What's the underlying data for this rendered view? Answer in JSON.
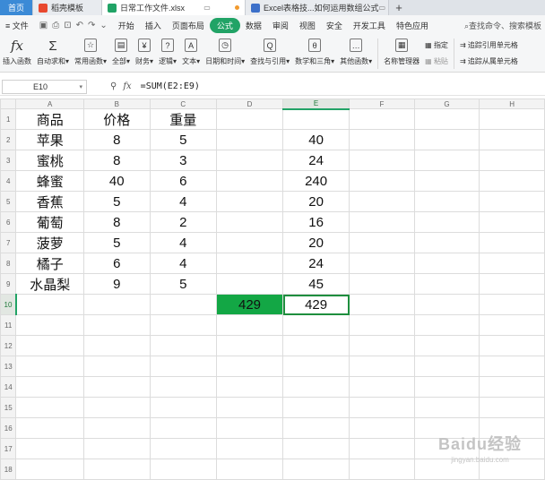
{
  "tabs": {
    "home": "首页",
    "tab1": "稻壳模板",
    "tab2": "日常工作文件.xlsx",
    "tab3": "Excel表格技...如何运用数组公式",
    "new_tab": "+"
  },
  "menu": {
    "file": "文件",
    "items": [
      "开始",
      "插入",
      "页面布局",
      "公式",
      "数据",
      "审阅",
      "视图",
      "安全",
      "开发工具",
      "特色应用"
    ],
    "active": "公式",
    "search": "查找命令、搜索模板"
  },
  "ribbon": {
    "buttons": [
      {
        "label": "插入函数",
        "icon": "fx"
      },
      {
        "label": "自动求和▾",
        "icon": "Σ"
      },
      {
        "label": "常用函数▾",
        "icon": "☆"
      },
      {
        "label": "全部▾",
        "icon": "▤"
      },
      {
        "label": "财务▾",
        "icon": "¥"
      },
      {
        "label": "逻辑▾",
        "icon": "?"
      },
      {
        "label": "文本▾",
        "icon": "A"
      },
      {
        "label": "日期和时间▾",
        "icon": "◷"
      },
      {
        "label": "查找与引用▾",
        "icon": "Q"
      },
      {
        "label": "数学和三角▾",
        "icon": "θ"
      },
      {
        "label": "其他函数▾",
        "icon": "…"
      },
      {
        "label": "名称管理器",
        "icon": "▦"
      }
    ],
    "small_a": [
      "指定",
      "粘贴"
    ],
    "small_b": [
      "追踪引用单元格",
      "追踪从属单元格"
    ]
  },
  "formula_bar": {
    "cell_ref": "E10",
    "formula": "=SUM(E2:E9)"
  },
  "sheet": {
    "columns": [
      "A",
      "B",
      "C",
      "D",
      "E",
      "F",
      "G",
      "H"
    ],
    "selected_column": "E",
    "selected_row": "10",
    "rows": [
      {
        "n": "1",
        "cells": [
          "商品",
          "价格",
          "重量",
          "",
          "",
          "",
          "",
          ""
        ]
      },
      {
        "n": "2",
        "cells": [
          "苹果",
          "8",
          "5",
          "",
          "40",
          "",
          "",
          ""
        ]
      },
      {
        "n": "3",
        "cells": [
          "蜜桃",
          "8",
          "3",
          "",
          "24",
          "",
          "",
          ""
        ]
      },
      {
        "n": "4",
        "cells": [
          "蜂蜜",
          "40",
          "6",
          "",
          "240",
          "",
          "",
          ""
        ]
      },
      {
        "n": "5",
        "cells": [
          "香蕉",
          "5",
          "4",
          "",
          "20",
          "",
          "",
          ""
        ]
      },
      {
        "n": "6",
        "cells": [
          "葡萄",
          "8",
          "2",
          "",
          "16",
          "",
          "",
          ""
        ]
      },
      {
        "n": "7",
        "cells": [
          "菠萝",
          "5",
          "4",
          "",
          "20",
          "",
          "",
          ""
        ]
      },
      {
        "n": "8",
        "cells": [
          "橘子",
          "6",
          "4",
          "",
          "24",
          "",
          "",
          ""
        ]
      },
      {
        "n": "9",
        "cells": [
          "水晶梨",
          "9",
          "5",
          "",
          "45",
          "",
          "",
          ""
        ]
      },
      {
        "n": "10",
        "cells": [
          "",
          "",
          "",
          "429",
          "429",
          "",
          "",
          ""
        ]
      },
      {
        "n": "11",
        "cells": [
          "",
          "",
          "",
          "",
          "",
          "",
          "",
          ""
        ]
      },
      {
        "n": "12",
        "cells": [
          "",
          "",
          "",
          "",
          "",
          "",
          "",
          ""
        ]
      },
      {
        "n": "13",
        "cells": [
          "",
          "",
          "",
          "",
          "",
          "",
          "",
          ""
        ]
      },
      {
        "n": "14",
        "cells": [
          "",
          "",
          "",
          "",
          "",
          "",
          "",
          ""
        ]
      },
      {
        "n": "15",
        "cells": [
          "",
          "",
          "",
          "",
          "",
          "",
          "",
          ""
        ]
      },
      {
        "n": "16",
        "cells": [
          "",
          "",
          "",
          "",
          "",
          "",
          "",
          ""
        ]
      },
      {
        "n": "17",
        "cells": [
          "",
          "",
          "",
          "",
          "",
          "",
          "",
          ""
        ]
      },
      {
        "n": "18",
        "cells": [
          "",
          "",
          "",
          "",
          "",
          "",
          "",
          ""
        ]
      }
    ]
  },
  "watermark": {
    "text": "Baidu经验",
    "sub": "jingyan.baidu.com"
  },
  "colors": {
    "accent": "#21a366",
    "highlight_fill": "#13a745",
    "home_tab": "#3b8ad6"
  }
}
